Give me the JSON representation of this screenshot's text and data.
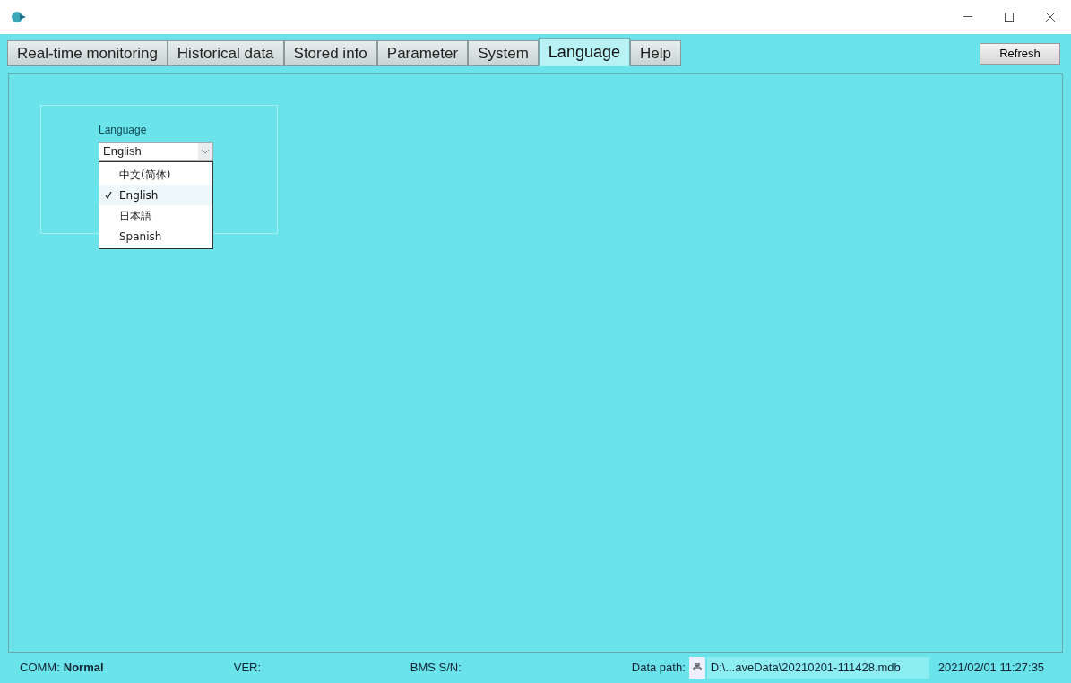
{
  "tabs": [
    {
      "label": "Real-time monitoring",
      "selected": false
    },
    {
      "label": "Historical data",
      "selected": false
    },
    {
      "label": "Stored info",
      "selected": false
    },
    {
      "label": "Parameter",
      "selected": false
    },
    {
      "label": "System",
      "selected": false
    },
    {
      "label": "Language",
      "selected": true
    },
    {
      "label": "Help",
      "selected": false
    }
  ],
  "refresh_button": "Refresh",
  "language": {
    "label": "Language",
    "value": "English",
    "expanded": true,
    "options": [
      {
        "label": "中文(简体)",
        "selected": false
      },
      {
        "label": "English",
        "selected": true
      },
      {
        "label": "日本語",
        "selected": false
      },
      {
        "label": "Spanish",
        "selected": false
      }
    ]
  },
  "status_bar": {
    "comm_label": "COMM:",
    "comm_value": "Normal",
    "ver_label": "VER:",
    "sn_label": "BMS S/N:",
    "data_path_label": "Data path:",
    "data_path": "D:\\...aveData\\20210201-111428.mdb",
    "datetime": "2021/02/01 11:27:35"
  }
}
